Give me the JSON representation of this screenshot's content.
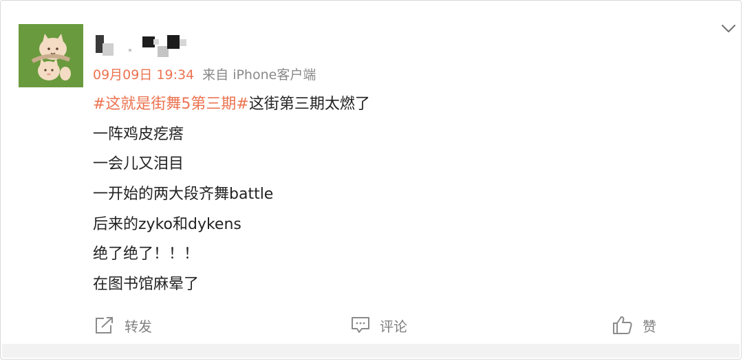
{
  "post": {
    "meta": {
      "time": "09月09日 19:34",
      "source": "来自 iPhone客户端"
    },
    "first_line": {
      "topic": "#这就是街舞5第三期#",
      "text": "这街第三期太燃了"
    },
    "lines": [
      "一阵鸡皮疙瘩",
      "一会儿又泪目",
      "一开始的两大段齐舞battle",
      "后来的zyko和dykens",
      "绝了绝了！！！",
      "在图书馆麻晕了"
    ]
  },
  "actions": {
    "repost_label": "转发",
    "comment_label": "评论",
    "like_label": "赞"
  },
  "colors": {
    "accent": "#eb7350",
    "meta_gray": "#888888",
    "avatar_bg": "#6a9a3e"
  },
  "icons": [
    "chevron-down-icon",
    "repost-icon",
    "comment-icon",
    "like-icon"
  ]
}
